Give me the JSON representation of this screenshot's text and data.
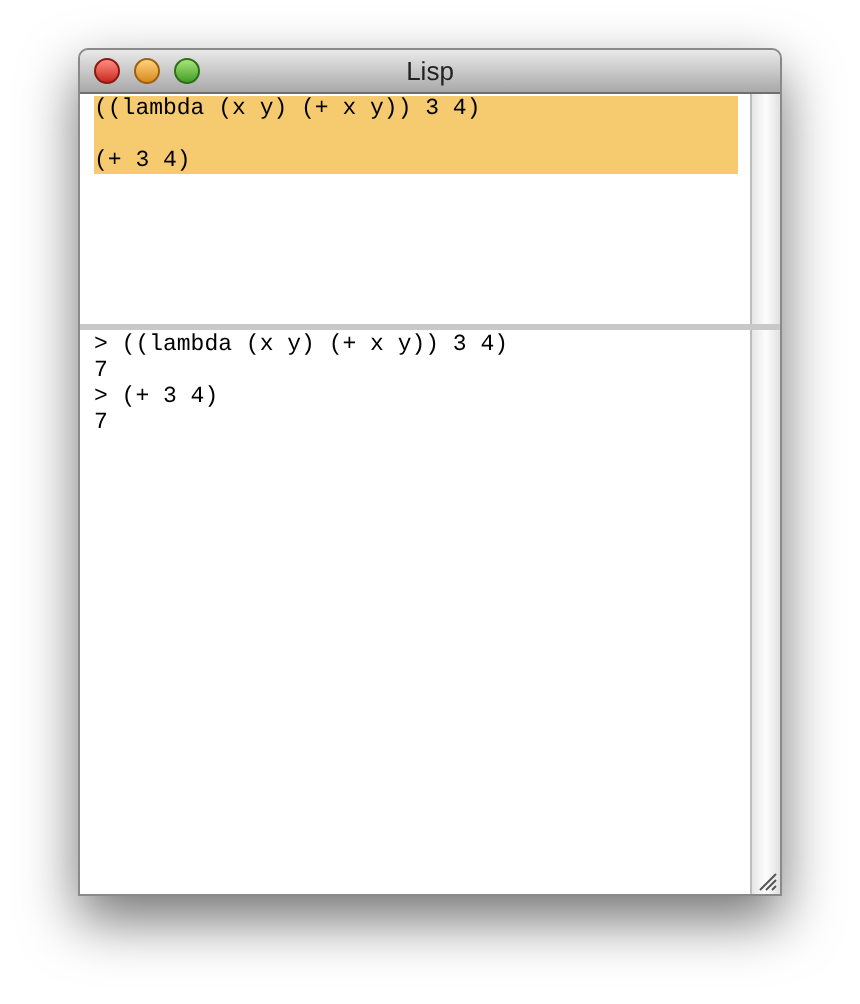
{
  "window": {
    "title": "Lisp"
  },
  "editor": {
    "lines": [
      {
        "text": "((lambda (x y) (+ x y)) 3 4)",
        "selected": true
      },
      {
        "text": "(+ 3 4)",
        "selected": true
      }
    ]
  },
  "transcript": {
    "lines": [
      {
        "text": "> ((lambda (x y) (+ x y)) 3 4)"
      },
      {
        "text": "7"
      },
      {
        "text": "> (+ 3 4)"
      },
      {
        "text": "7"
      }
    ]
  }
}
